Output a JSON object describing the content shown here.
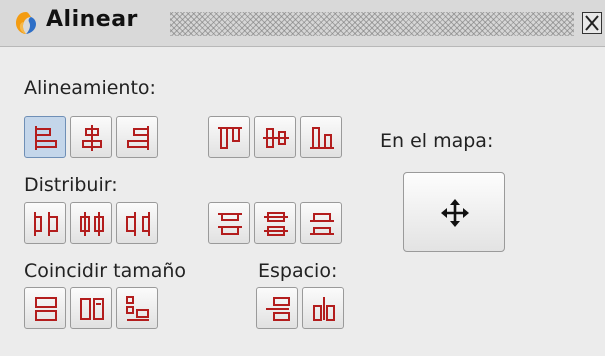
{
  "window": {
    "title": "Alinear",
    "icon": "orange-pin-icon",
    "close_icon": "close-icon"
  },
  "sections": {
    "alignment_label": "Alineamiento:",
    "distribute_label": "Distribuir:",
    "match_size_label": "Coincidir tamaño",
    "spacing_label": "Espacio:",
    "on_map_label": "En el mapa:"
  },
  "alignment_buttons": [
    {
      "icon": "align-left-icon",
      "active": true
    },
    {
      "icon": "align-center-horizontal-icon",
      "active": false
    },
    {
      "icon": "align-right-icon",
      "active": false
    },
    {
      "icon": "align-top-icon",
      "active": false
    },
    {
      "icon": "align-center-vertical-icon",
      "active": false
    },
    {
      "icon": "align-bottom-icon",
      "active": false
    }
  ],
  "distribute_buttons": [
    {
      "icon": "distribute-left-icon"
    },
    {
      "icon": "distribute-center-horizontal-icon"
    },
    {
      "icon": "distribute-right-icon"
    },
    {
      "icon": "distribute-top-icon"
    },
    {
      "icon": "distribute-center-vertical-icon"
    },
    {
      "icon": "distribute-bottom-icon"
    }
  ],
  "match_size_buttons": [
    {
      "icon": "match-width-icon"
    },
    {
      "icon": "match-height-icon"
    },
    {
      "icon": "match-size-icon"
    }
  ],
  "spacing_buttons": [
    {
      "icon": "space-vertical-icon"
    },
    {
      "icon": "space-horizontal-icon"
    }
  ],
  "map_button": {
    "icon": "move-arrows-icon"
  },
  "colors": {
    "background": "#ececec",
    "icon_red": "#b31d1d",
    "active_button": "#c4d6ea",
    "logo_orange": "#f39c12",
    "logo_blue": "#2e6fc7"
  }
}
